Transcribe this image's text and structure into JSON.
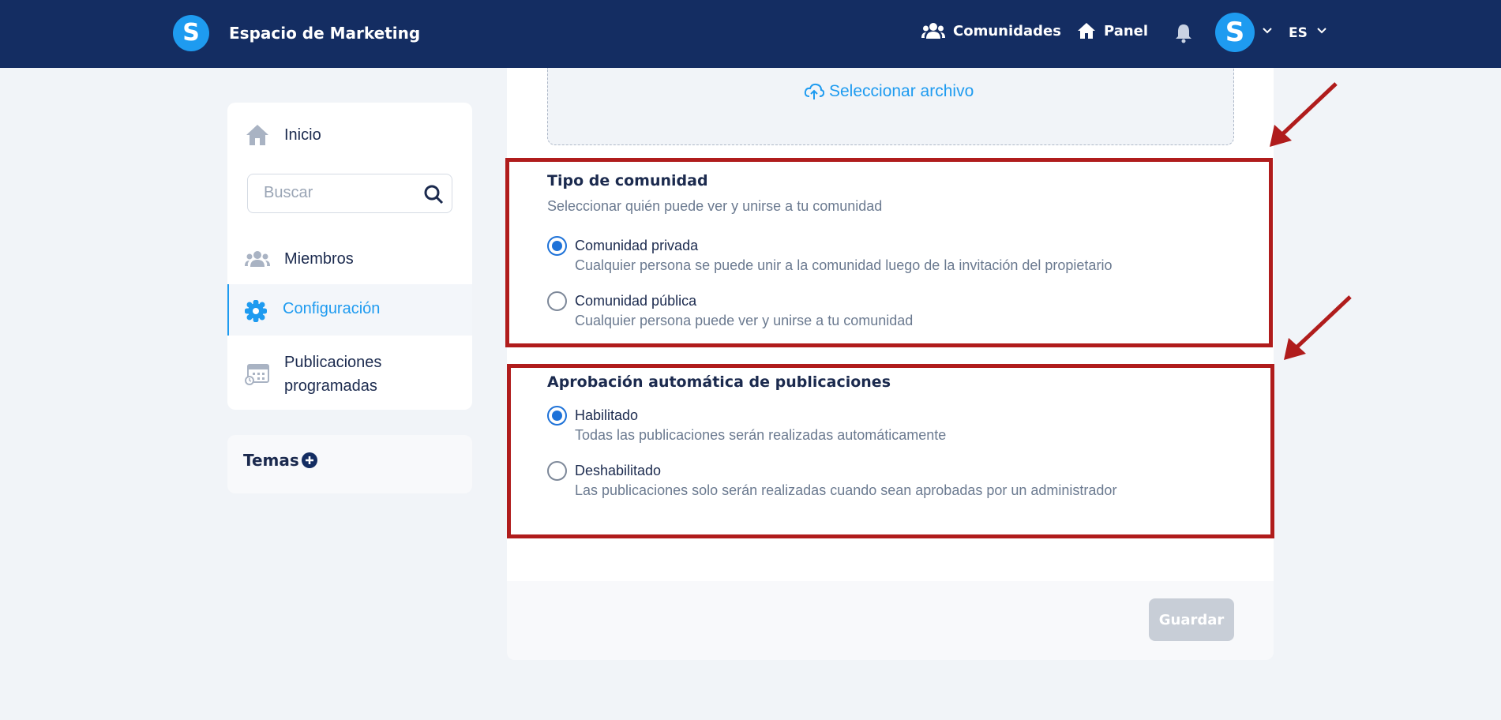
{
  "header": {
    "logo_letter": "S",
    "app_title": "Espacio de Marketing",
    "nav": {
      "communities": "Comunidades",
      "panel": "Panel"
    },
    "avatar_letter": "S",
    "language": "ES",
    "icons": [
      "users-icon",
      "home-icon",
      "bell-icon",
      "chevron-down-icon"
    ]
  },
  "sidebar": {
    "home_label": "Inicio",
    "search_placeholder": "Buscar",
    "members_label": "Miembros",
    "config_label": "Configuración",
    "scheduled_label": "Publicaciones programadas",
    "topics_label": "Temas"
  },
  "main": {
    "upload_label": "Seleccionar archivo",
    "community_type": {
      "title": "Tipo de comunidad",
      "subtitle": "Seleccionar quién puede ver y unirse a tu comunidad",
      "options": [
        {
          "label": "Comunidad privada",
          "desc": "Cualquier persona se puede unir a la comunidad luego de la invitación del propietario",
          "checked": true
        },
        {
          "label": "Comunidad pública",
          "desc": "Cualquier persona puede ver y unirse a tu comunidad",
          "checked": false
        }
      ]
    },
    "auto_approval": {
      "title": "Aprobación automática de publicaciones",
      "options": [
        {
          "label": "Habilitado",
          "desc": "Todas las publicaciones serán realizadas automáticamente",
          "checked": true
        },
        {
          "label": "Deshabilitado",
          "desc": "Las publicaciones solo serán realizadas cuando sean aprobadas por un administrador",
          "checked": false
        }
      ]
    },
    "save_label": "Guardar"
  },
  "colors": {
    "header_bg": "#142d62",
    "accent": "#1e9bf0",
    "radio_checked": "#1e72d8",
    "annotation": "#b01c1c"
  }
}
